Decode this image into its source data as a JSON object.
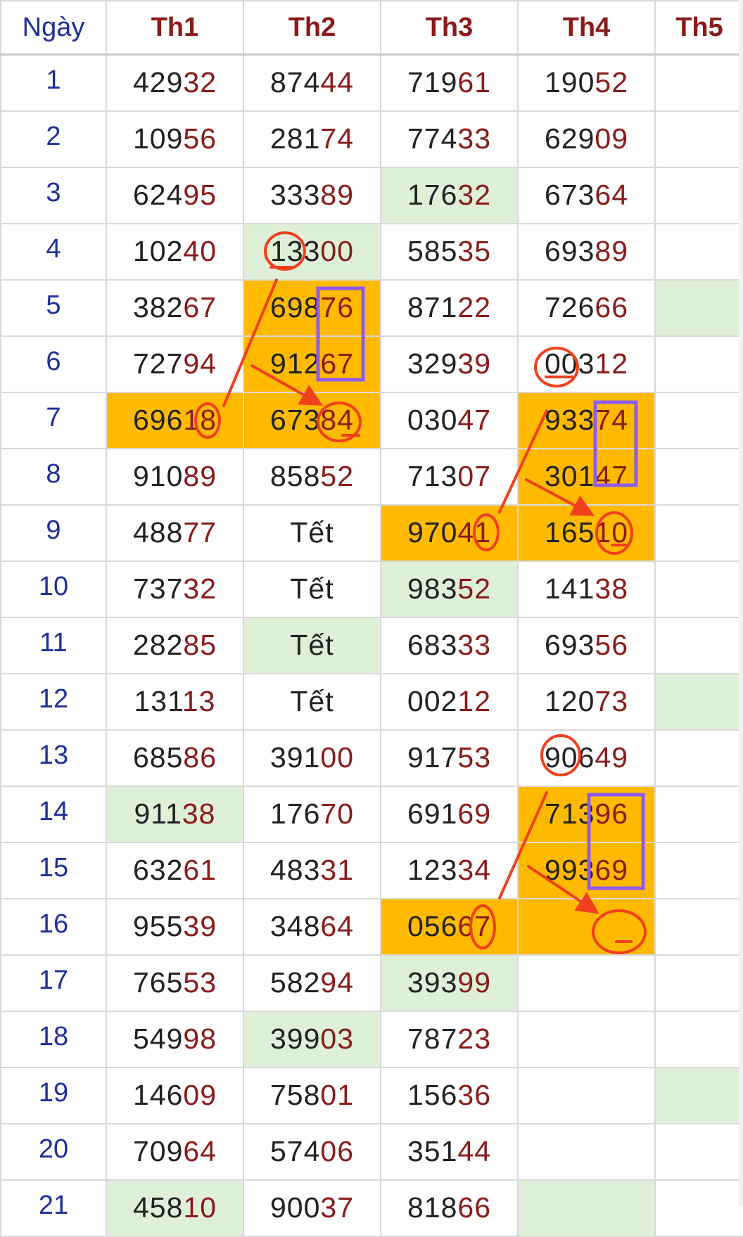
{
  "header": {
    "day_label": "Ngày",
    "columns": [
      "Th1",
      "Th2",
      "Th3",
      "Th4",
      "Th5"
    ]
  },
  "rows": [
    {
      "day": "1",
      "cells": [
        "42932",
        "87444",
        "71961",
        "19052",
        ""
      ]
    },
    {
      "day": "2",
      "cells": [
        "10956",
        "28174",
        "77433",
        "62909",
        ""
      ]
    },
    {
      "day": "3",
      "cells": [
        "62495",
        "33389",
        "17632",
        "67364",
        ""
      ]
    },
    {
      "day": "4",
      "cells": [
        "10240",
        "13300",
        "58535",
        "69389",
        ""
      ]
    },
    {
      "day": "5",
      "cells": [
        "38267",
        "69876",
        "87122",
        "72666",
        ""
      ]
    },
    {
      "day": "6",
      "cells": [
        "72794",
        "91267",
        "32939",
        "00312",
        ""
      ]
    },
    {
      "day": "7",
      "cells": [
        "69618",
        "67384",
        "03047",
        "93374",
        ""
      ]
    },
    {
      "day": "8",
      "cells": [
        "91089",
        "85852",
        "71307",
        "30147",
        ""
      ]
    },
    {
      "day": "9",
      "cells": [
        "48877",
        "Tết",
        "97041",
        "16510",
        ""
      ]
    },
    {
      "day": "10",
      "cells": [
        "73732",
        "Tết",
        "98352",
        "14138",
        ""
      ]
    },
    {
      "day": "11",
      "cells": [
        "28285",
        "Tết",
        "68333",
        "69356",
        ""
      ]
    },
    {
      "day": "12",
      "cells": [
        "13113",
        "Tết",
        "00212",
        "12073",
        ""
      ]
    },
    {
      "day": "13",
      "cells": [
        "68586",
        "39100",
        "91753",
        "90649",
        ""
      ]
    },
    {
      "day": "14",
      "cells": [
        "91138",
        "17670",
        "69169",
        "71396",
        ""
      ]
    },
    {
      "day": "15",
      "cells": [
        "63261",
        "48331",
        "12334",
        "99369",
        ""
      ]
    },
    {
      "day": "16",
      "cells": [
        "95539",
        "34864",
        "05667",
        "",
        ""
      ]
    },
    {
      "day": "17",
      "cells": [
        "76553",
        "58294",
        "39399",
        "",
        ""
      ]
    },
    {
      "day": "18",
      "cells": [
        "54998",
        "39903",
        "78723",
        "",
        ""
      ]
    },
    {
      "day": "19",
      "cells": [
        "14609",
        "75801",
        "15636",
        "",
        ""
      ]
    },
    {
      "day": "20",
      "cells": [
        "70964",
        "57406",
        "35144",
        "",
        ""
      ]
    },
    {
      "day": "21",
      "cells": [
        "45810",
        "90037",
        "81866",
        "",
        ""
      ]
    }
  ],
  "cell_highlights": {
    "3": [
      "",
      "",
      "green",
      "",
      ""
    ],
    "4": [
      "",
      "green",
      "",
      "",
      ""
    ],
    "5": [
      "",
      "orange",
      "",
      "",
      "green"
    ],
    "6": [
      "",
      "orange",
      "",
      "",
      ""
    ],
    "7": [
      "orange",
      "orange",
      "",
      "orange",
      ""
    ],
    "8": [
      "",
      "",
      "",
      "orange",
      ""
    ],
    "9": [
      "",
      "",
      "orange",
      "orange",
      ""
    ],
    "10": [
      "",
      "",
      "green",
      "",
      ""
    ],
    "11": [
      "",
      "green",
      "",
      "",
      ""
    ],
    "12": [
      "",
      "",
      "",
      "",
      "green"
    ],
    "14": [
      "green",
      "",
      "",
      "orange",
      ""
    ],
    "15": [
      "",
      "",
      "",
      "orange",
      ""
    ],
    "16": [
      "",
      "",
      "orange",
      "orange",
      ""
    ],
    "17": [
      "",
      "",
      "green",
      "",
      ""
    ],
    "18": [
      "",
      "green",
      "",
      "",
      ""
    ],
    "19": [
      "",
      "",
      "",
      "",
      "green"
    ],
    "21": [
      "green",
      "",
      "",
      "green",
      ""
    ]
  },
  "colors": {
    "day_text": "#1f2f9a",
    "header_text": "#8b1a1a",
    "tail_digits": "#8b1a1a",
    "green_cell": "#dff0d8",
    "orange_cell": "#ffba00",
    "annotation_red": "#f0401e",
    "annotation_purple": "#8e5cf0"
  }
}
